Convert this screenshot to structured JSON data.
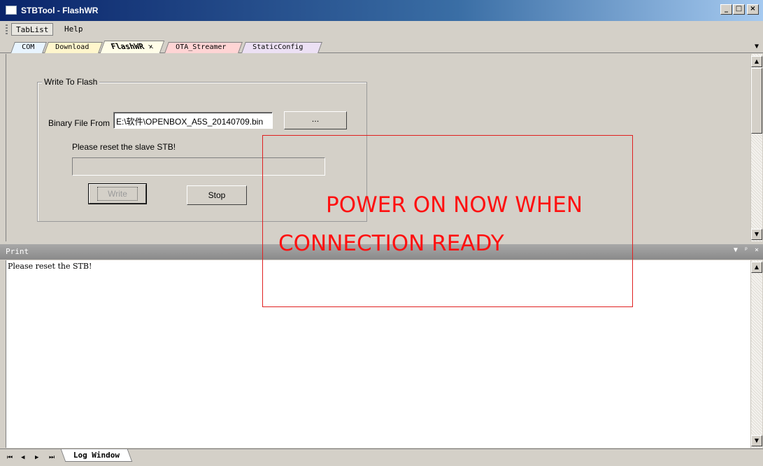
{
  "window": {
    "title": "STBTool - FlashWR",
    "minimize_glyph": "_",
    "maximize_glyph": "□",
    "close_glyph": "×"
  },
  "menu": {
    "items": [
      "TabList",
      "Help"
    ]
  },
  "tabs": [
    {
      "label": "COM"
    },
    {
      "label": "Download"
    },
    {
      "label": "FlashWR",
      "close_glyph": "✕",
      "active": true
    },
    {
      "label": "OTA_Streamer"
    },
    {
      "label": "StaticConfig"
    }
  ],
  "tab_dropdown_glyph": "▼",
  "flash_panel": {
    "group_title": "Write To Flash",
    "binary_label": "Binary File From",
    "binary_path": "E:\\软件\\OPENBOX_A5S_20140709.bin",
    "browse_label": "...",
    "status_text": "Please reset the slave STB!",
    "progress_percent": 0,
    "write_label": "Write",
    "stop_label": "Stop"
  },
  "annotation": {
    "line1": "POWER ON NOW WHEN",
    "line2": "CONNECTION READY",
    "color": "#ff1010"
  },
  "print_panel": {
    "title": "Print",
    "menu_glyph": "▼",
    "pin_glyph": "ᵖ",
    "close_glyph": "×",
    "log_lines": [
      "Please reset the STB!"
    ]
  },
  "bottom": {
    "nav": [
      "⏮",
      "◀",
      "▶",
      "⏭"
    ],
    "tab_label": "Log Window"
  }
}
